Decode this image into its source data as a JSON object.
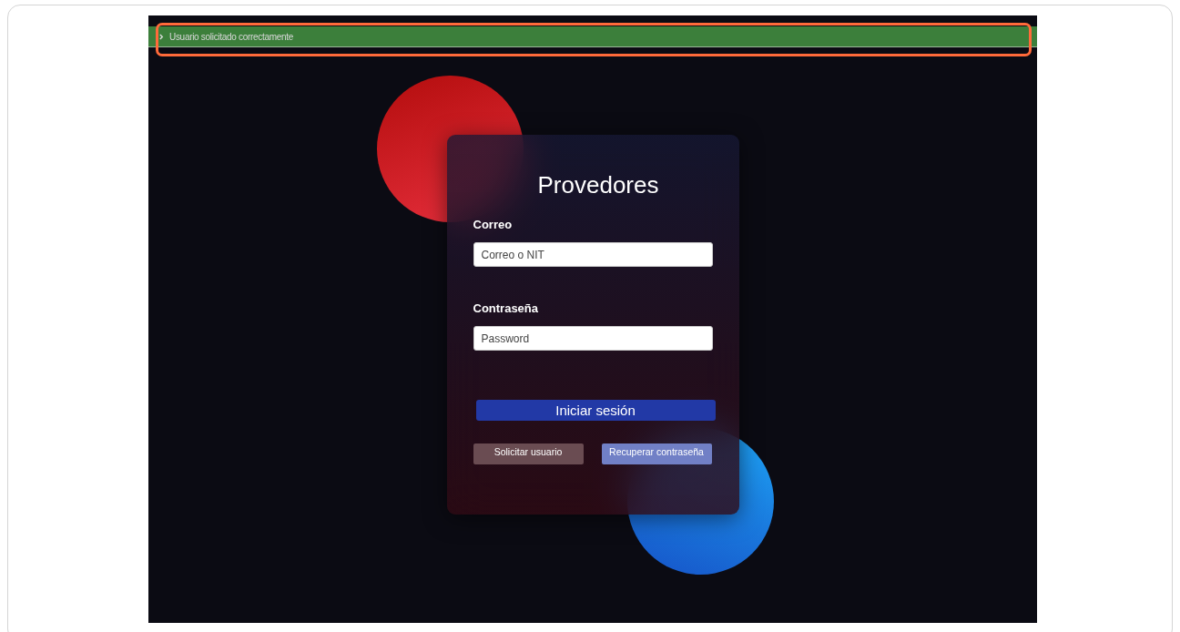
{
  "notification": {
    "text": "Usuario solicitado correctamente",
    "highlighted": true
  },
  "login": {
    "title": "Provedores",
    "fields": [
      {
        "label": "Correo",
        "placeholder": "Correo o NIT"
      },
      {
        "label": "Contraseña",
        "placeholder": "Password"
      }
    ],
    "submit": "Iniciar sesión",
    "links": [
      "Solicitar usuario",
      "Recuperar contraseña"
    ]
  }
}
